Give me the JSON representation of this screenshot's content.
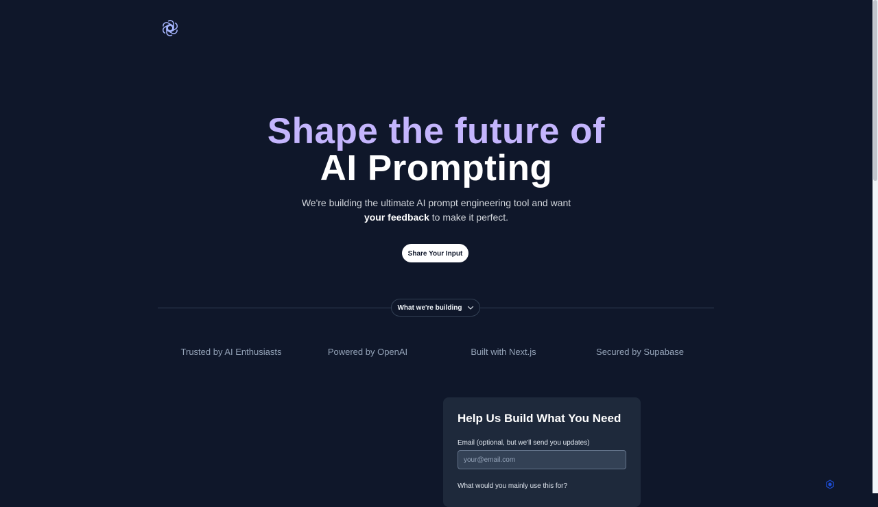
{
  "hero": {
    "line1": "Shape the future of",
    "line2": "AI Prompting"
  },
  "subtitle": {
    "part1": "We're building the ultimate AI prompt engineering tool and want ",
    "bold": "your feedback",
    "part2": " to make it perfect."
  },
  "cta": {
    "label": "Share Your Input"
  },
  "building": {
    "label": "What we're building"
  },
  "trust": {
    "items": [
      "Trusted by AI Enthusiasts",
      "Powered by OpenAI",
      "Built with Next.js",
      "Secured by Supabase"
    ]
  },
  "form": {
    "title": "Help Us Build What You Need",
    "email_label": "Email (optional, but we'll send you updates)",
    "email_placeholder": "your@email.com",
    "email_value": "",
    "use_label": "What would you mainly use this for?"
  },
  "colors": {
    "background": "#0f172a",
    "accent_purple": "#c4b5fd",
    "card": "#1e293b"
  },
  "icons": {
    "logo": "openai-logo-icon",
    "dropdown": "chevron-down-icon",
    "badge": "hexagon-badge-icon"
  }
}
